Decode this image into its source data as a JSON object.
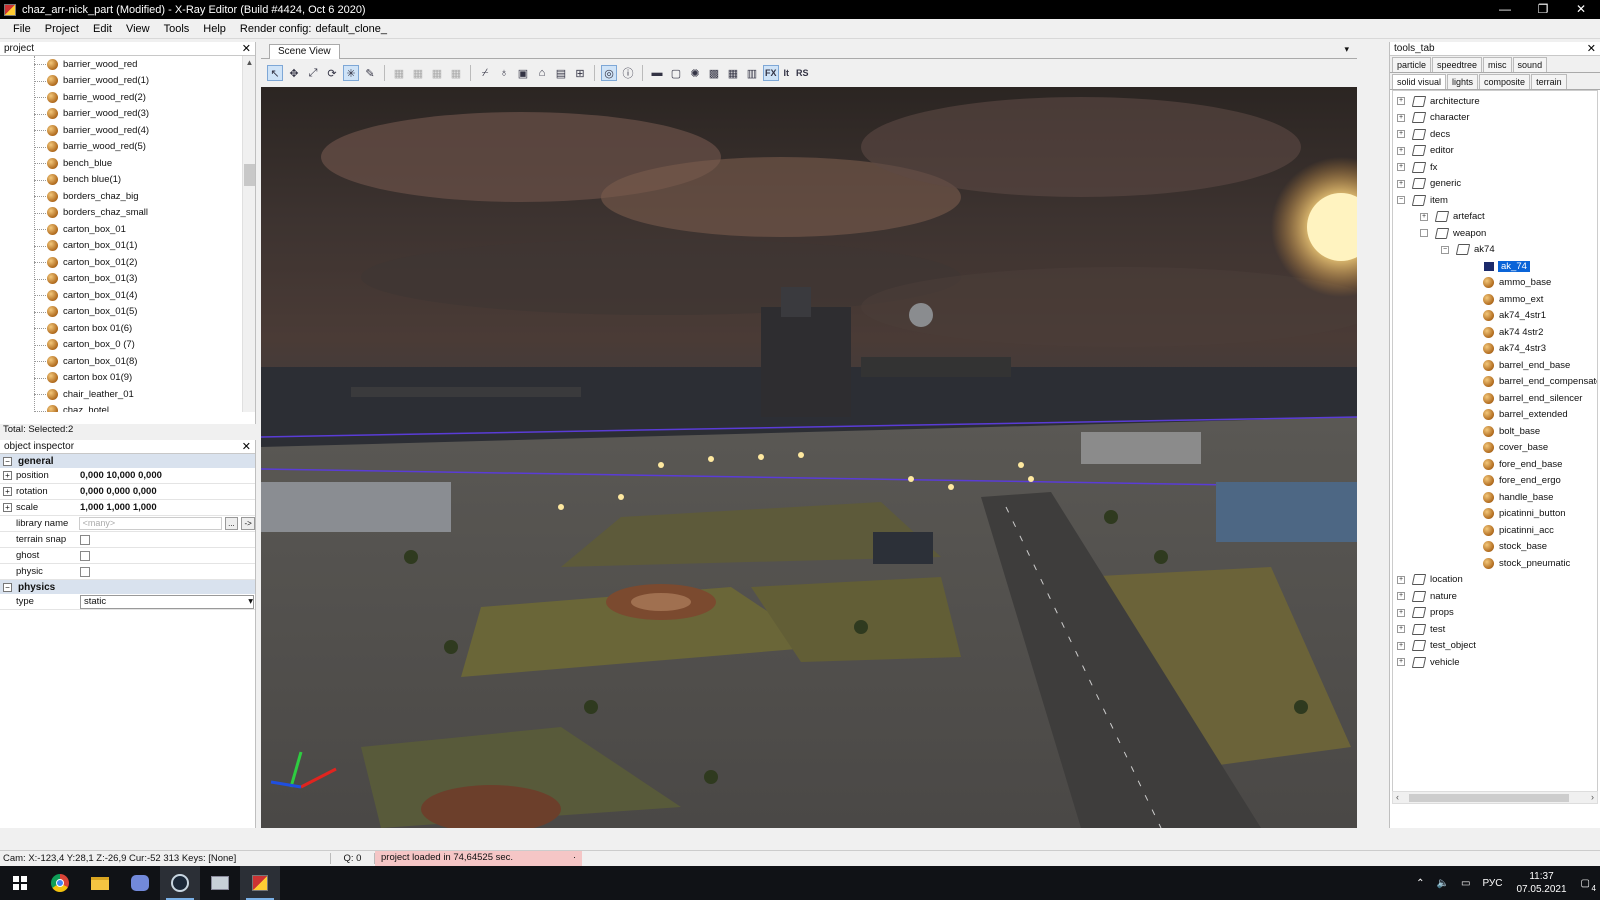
{
  "window": {
    "title": "chaz_arr-nick_part (Modified) - X-Ray Editor (Build #4424, Oct 6 2020)",
    "minimize": "—",
    "restore": "❐",
    "close": "✕"
  },
  "menu": [
    "File",
    "Project",
    "Edit",
    "View",
    "Tools",
    "Help",
    "Render config:",
    "default_clone_"
  ],
  "project_panel": {
    "title": "project",
    "close": "✕",
    "items": [
      "barrier_wood_red",
      "barrier_wood_red(1)",
      "barrie_wood_red(2)",
      "barrier_wood_red(3)",
      "barrier_wood_red(4)",
      "barrie_wood_red(5)",
      "bench_blue",
      "bench blue(1)",
      "borders_chaz_big",
      "borders_chaz_small",
      "carton_box_01",
      "carton_box_01(1)",
      "carton_box_01(2)",
      "carton_box_01(3)",
      "carton_box_01(4)",
      "carton_box_01(5)",
      "carton box 01(6)",
      "carton_box_0 (7)",
      "carton_box_01(8)",
      "carton box 01(9)",
      "chair_leather_01",
      "chaz_hotel"
    ],
    "total_label": "Total: Selected:2"
  },
  "inspector": {
    "title": "object inspector",
    "close": "✕",
    "general_label": "general",
    "position_label": "position",
    "position_value": "0,000 10,000 0,000",
    "rotation_label": "rotation",
    "rotation_value": "0,000 0,000 0,000",
    "scale_label": "scale",
    "scale_value": "1,000 1,000 1,000",
    "library_label": "library name",
    "library_placeholder": "<many>",
    "library_btn1": "...",
    "library_btn2": "->",
    "terrain_snap_label": "terrain snap",
    "ghost_label": "ghost",
    "physic_label": "physic",
    "physics_label": "physics",
    "type_label": "type",
    "type_value": "static"
  },
  "scene": {
    "tab": "Scene View",
    "dropdown": "▾",
    "toolbar_text": [
      "FX",
      "It",
      "RS"
    ]
  },
  "tools_panel": {
    "title": "tools_tab",
    "close": "✕",
    "tabs_row1": [
      "particle",
      "speedtree",
      "misc",
      "sound"
    ],
    "tabs_row2": [
      "solid visual",
      "lights",
      "composite",
      "terrain"
    ],
    "tree": [
      "architecture",
      "character",
      "decs",
      "editor",
      "fx",
      "generic",
      "item",
      "artefact",
      "weapon",
      "ak74",
      "ak_74",
      "ammo_base",
      "ammo_ext",
      "ak74_4str1",
      "ak74 4str2",
      "ak74_4str3",
      "barrel_end_base",
      "barrel_end_compensato",
      "barrel_end_silencer",
      "barrel_extended",
      "bolt_base",
      "cover_base",
      "fore_end_base",
      "fore_end_ergo",
      "handle_base",
      "picatinni_button",
      "picatinni_acc",
      "stock_base",
      "stock_pneumatic",
      "location",
      "nature",
      "props",
      "test",
      "test_object",
      "vehicle"
    ]
  },
  "statusbar": {
    "cam": "Cam: X:-123,4 Y:28,1 Z:-26,9 Cur:-52 313 Keys: [None]",
    "q": "Q: 0",
    "message": "project loaded in 74,64525 sec.",
    "message_dot": "·"
  },
  "taskbar": {
    "tray_lang": "РУС",
    "time": "11:37",
    "date": "07.05.2021",
    "notif_count": "4"
  }
}
